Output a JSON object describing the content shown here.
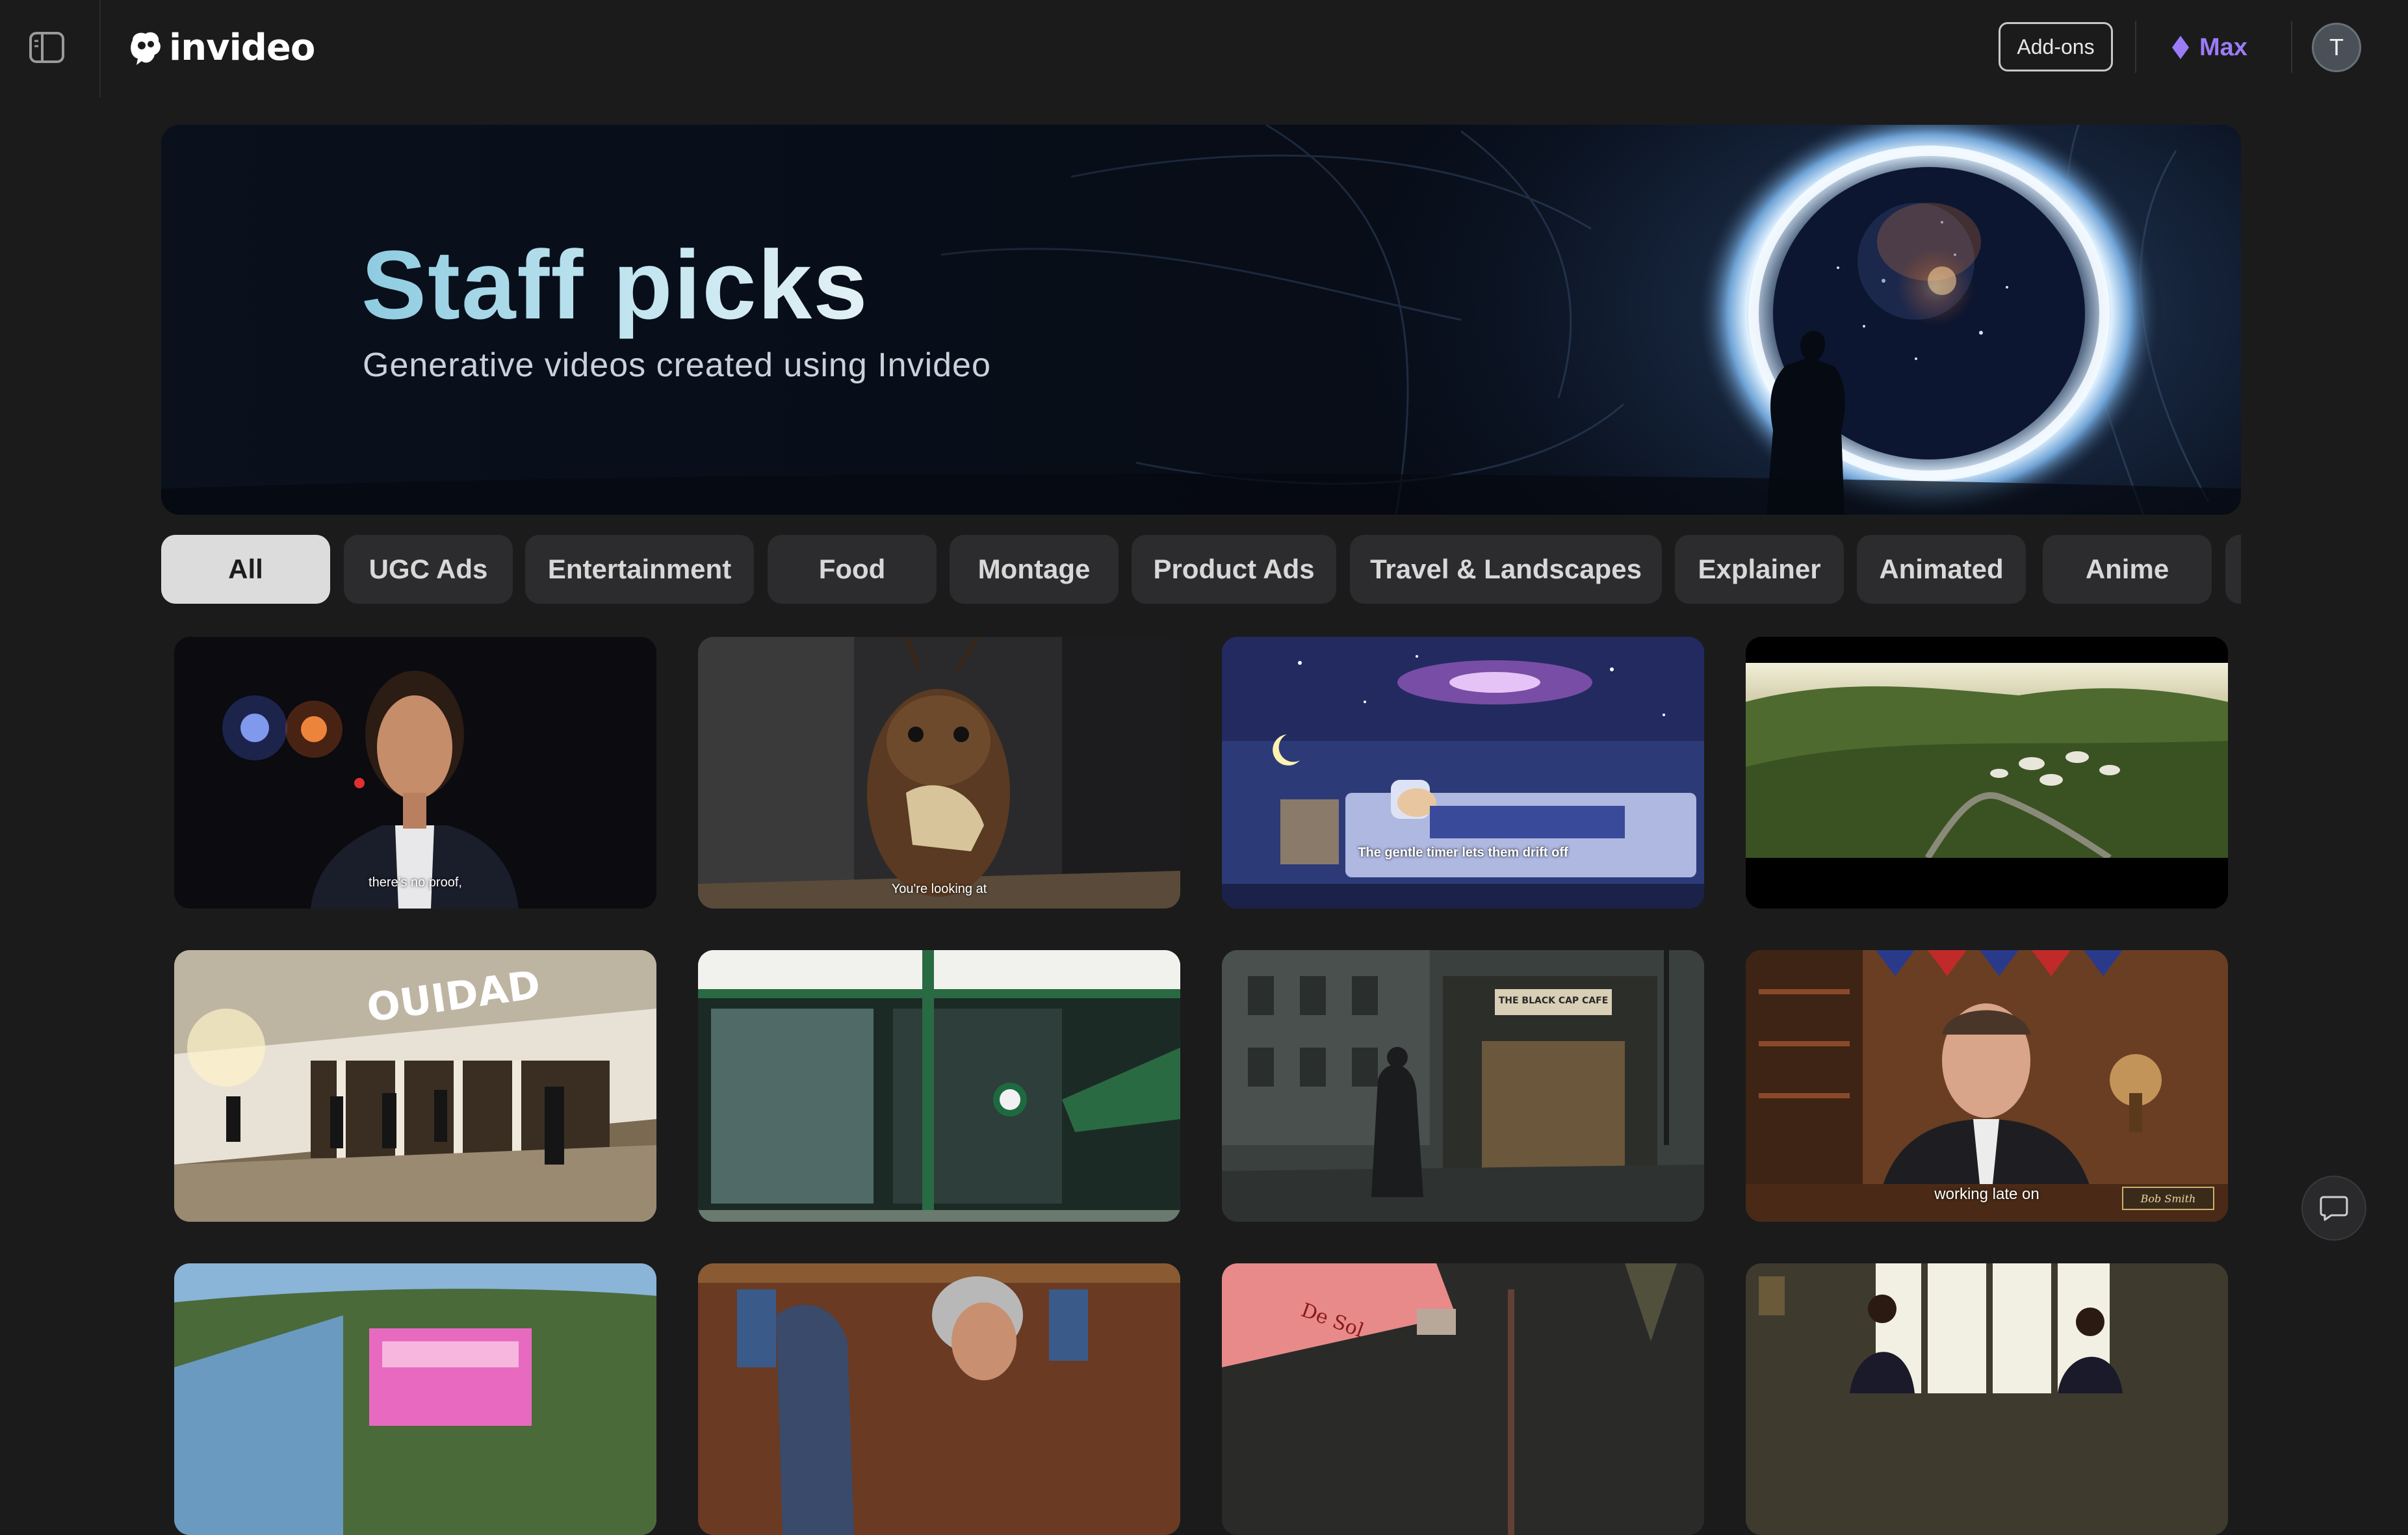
{
  "topbar": {
    "sidebar_toggle_icon": "sidebar-panel-icon",
    "logo_text": "invideo",
    "addons_label": "Add-ons",
    "plan_label": "Max",
    "plan_icon": "diamond-icon",
    "plan_color": "#9b7cf6",
    "avatar_initial": "T"
  },
  "hero": {
    "title": "Staff picks",
    "subtitle": "Generative videos created using Invideo"
  },
  "filters": {
    "selected": "All",
    "items": [
      "All",
      "UGC Ads",
      "Entertainment",
      "Food",
      "Montage",
      "Product Ads",
      "Travel & Landscapes",
      "Explainer",
      "Animated",
      "Anime"
    ]
  },
  "videos": [
    {
      "subject": "news reporter at night",
      "caption": "there's no proof,"
    },
    {
      "subject": "cricket eating bread",
      "caption": "You're looking at"
    },
    {
      "subject": "child sleeping under galaxy projection",
      "caption": "The gentle timer lets them drift off"
    },
    {
      "subject": "aerial forest glamping site",
      "caption": ""
    },
    {
      "subject": "storefront",
      "sign": "OUIDAD",
      "caption": ""
    },
    {
      "subject": "green coffee shop",
      "caption": ""
    },
    {
      "subject": "man walking to cafe",
      "sign": "THE BLACK CAP CAFE",
      "caption": ""
    },
    {
      "subject": "host at desk",
      "caption": "working late on",
      "nameplate": "Bob Smith"
    },
    {
      "subject": "pink coastal mansion",
      "caption": ""
    },
    {
      "subject": "woman shopping jackets",
      "caption": ""
    },
    {
      "subject": "pouring rosé wine",
      "label": "De Sol",
      "caption": ""
    },
    {
      "subject": "two people in living room",
      "caption": ""
    }
  ],
  "chat_icon": "chat-bubble-icon"
}
